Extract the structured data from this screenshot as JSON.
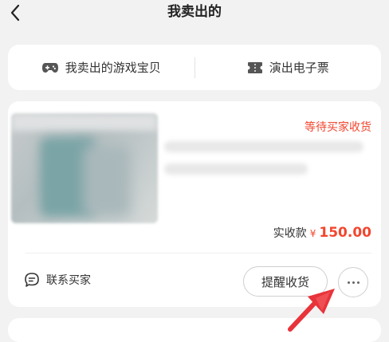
{
  "header": {
    "title": "我卖出的",
    "back_icon": "chevron-left-icon"
  },
  "tabs": [
    {
      "label": "我卖出的游戏宝贝",
      "icon": "gamepad-icon"
    },
    {
      "label": "演出电子票",
      "icon": "ticket-icon"
    }
  ],
  "order": {
    "status": "等待买家收货",
    "payment_label": "实收款",
    "currency": "¥",
    "amount": "150.00",
    "contact_label": "联系买家",
    "contact_icon": "chat-bubble-icon",
    "remind_label": "提醒收货",
    "more_icon": "more-dots-icon"
  },
  "colors": {
    "accent": "#f2462e",
    "background": "#f2f2f2",
    "annotation_arrow": "#e8333a"
  }
}
